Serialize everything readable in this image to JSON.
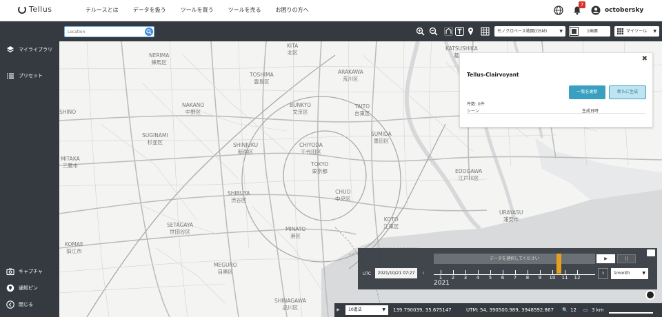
{
  "app": {
    "logo_text": "Tellus"
  },
  "nav": {
    "links": [
      "テルースとは",
      "データを扱う",
      "ツールを買う",
      "ツールを売る",
      "お困りの方へ"
    ],
    "notification_count": "7",
    "username": "octobersky"
  },
  "sidebar": {
    "items": [
      {
        "label": "マイライブラリ",
        "icon": "layers-icon"
      },
      {
        "label": "プリセット",
        "icon": "list-icon"
      },
      {
        "label": "キャプチャ",
        "icon": "camera-icon"
      },
      {
        "label": "通知ピン",
        "icon": "pin-icon"
      },
      {
        "label": "閉じる",
        "icon": "chevron-left-icon"
      }
    ]
  },
  "toolbar": {
    "location_placeholder": "Location",
    "basemap": "モノクロベース地図(OSM)",
    "interval": "1画面",
    "mytools": "マイツール"
  },
  "library_panel": {
    "title": "Tellus-Clairvoyant",
    "update_button": "一覧を更新",
    "new_button": "新たに生成",
    "count": "件数: 0件",
    "scene_header": "シーン",
    "date_header": "生成日時"
  },
  "timeline": {
    "prompt": "データを選択してください",
    "play": "▶",
    "pause": "||",
    "utc_label": "UTC",
    "datetime": "2021/10/21 07:27",
    "period": "1month",
    "year": "2021",
    "months": [
      "1",
      "2",
      "3",
      "4",
      "5",
      "6",
      "7",
      "8",
      "9",
      "10",
      "11",
      "12"
    ],
    "current_month": 10.5
  },
  "statusbar": {
    "projection": "10進法",
    "coords": "139.790039, 35.675147",
    "utm": "UTM: 54, 390500.989, 3948592.867",
    "zoom": "12",
    "scale": "3 km"
  },
  "map_labels": [
    {
      "en": "NERIMA",
      "ja": "練馬区"
    },
    {
      "en": "TOSHIMA",
      "ja": "豊島区"
    },
    {
      "en": "KITA",
      "ja": "北区"
    },
    {
      "en": "ARAKAWA",
      "ja": "荒川区"
    },
    {
      "en": "KATSUSHIKA",
      "ja": "葛飾区"
    },
    {
      "en": "NAKANO",
      "ja": "中野区"
    },
    {
      "en": "BUNKYO",
      "ja": "文京区"
    },
    {
      "en": "TAITO",
      "ja": "台東区"
    },
    {
      "en": "SUGINAMI",
      "ja": "杉並区"
    },
    {
      "en": "SHINJUKU",
      "ja": "新宿区"
    },
    {
      "en": "CHIYODA",
      "ja": "千代田区"
    },
    {
      "en": "SUMIDA",
      "ja": "墨田区"
    },
    {
      "en": "TOKYO",
      "ja": "東京都"
    },
    {
      "en": "MITAKA",
      "ja": "三鷹市"
    },
    {
      "en": "EDOGAWA",
      "ja": "江戸川区"
    },
    {
      "en": "SHIBUYA",
      "ja": "渋谷区"
    },
    {
      "en": "CHUO",
      "ja": "中央区"
    },
    {
      "en": "KOTO",
      "ja": "江東区"
    },
    {
      "en": "URAYASU",
      "ja": "浦安市"
    },
    {
      "en": "SETAGAYA",
      "ja": "世田谷区"
    },
    {
      "en": "MINATO",
      "ja": "港区"
    },
    {
      "en": "KOMAE",
      "ja": "狛江市"
    },
    {
      "en": "MEGURO",
      "ja": "目黒区"
    },
    {
      "en": "SHINAGAWA",
      "ja": "品川区"
    },
    {
      "en": "SHINO",
      "ja": ""
    }
  ]
}
